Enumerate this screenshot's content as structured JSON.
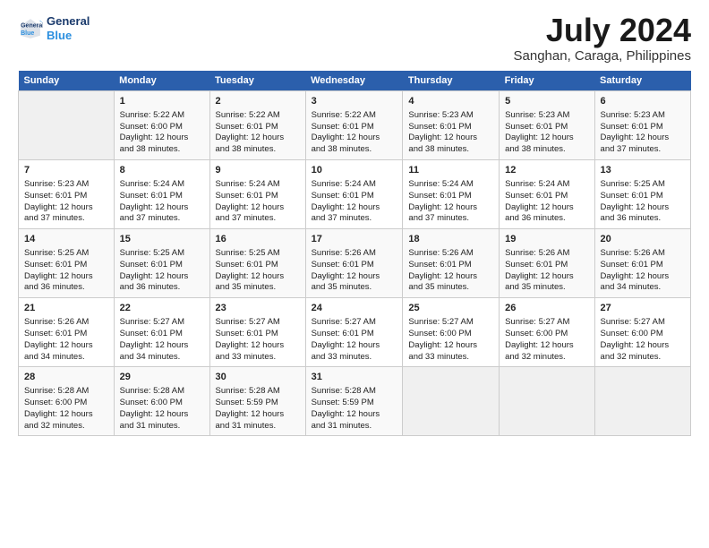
{
  "header": {
    "logo_line1": "General",
    "logo_line2": "Blue",
    "month": "July 2024",
    "location": "Sanghan, Caraga, Philippines"
  },
  "days_of_week": [
    "Sunday",
    "Monday",
    "Tuesday",
    "Wednesday",
    "Thursday",
    "Friday",
    "Saturday"
  ],
  "weeks": [
    [
      {
        "num": "",
        "detail": ""
      },
      {
        "num": "1",
        "detail": "Sunrise: 5:22 AM\nSunset: 6:00 PM\nDaylight: 12 hours\nand 38 minutes."
      },
      {
        "num": "2",
        "detail": "Sunrise: 5:22 AM\nSunset: 6:01 PM\nDaylight: 12 hours\nand 38 minutes."
      },
      {
        "num": "3",
        "detail": "Sunrise: 5:22 AM\nSunset: 6:01 PM\nDaylight: 12 hours\nand 38 minutes."
      },
      {
        "num": "4",
        "detail": "Sunrise: 5:23 AM\nSunset: 6:01 PM\nDaylight: 12 hours\nand 38 minutes."
      },
      {
        "num": "5",
        "detail": "Sunrise: 5:23 AM\nSunset: 6:01 PM\nDaylight: 12 hours\nand 38 minutes."
      },
      {
        "num": "6",
        "detail": "Sunrise: 5:23 AM\nSunset: 6:01 PM\nDaylight: 12 hours\nand 37 minutes."
      }
    ],
    [
      {
        "num": "7",
        "detail": "Sunrise: 5:23 AM\nSunset: 6:01 PM\nDaylight: 12 hours\nand 37 minutes."
      },
      {
        "num": "8",
        "detail": "Sunrise: 5:24 AM\nSunset: 6:01 PM\nDaylight: 12 hours\nand 37 minutes."
      },
      {
        "num": "9",
        "detail": "Sunrise: 5:24 AM\nSunset: 6:01 PM\nDaylight: 12 hours\nand 37 minutes."
      },
      {
        "num": "10",
        "detail": "Sunrise: 5:24 AM\nSunset: 6:01 PM\nDaylight: 12 hours\nand 37 minutes."
      },
      {
        "num": "11",
        "detail": "Sunrise: 5:24 AM\nSunset: 6:01 PM\nDaylight: 12 hours\nand 37 minutes."
      },
      {
        "num": "12",
        "detail": "Sunrise: 5:24 AM\nSunset: 6:01 PM\nDaylight: 12 hours\nand 36 minutes."
      },
      {
        "num": "13",
        "detail": "Sunrise: 5:25 AM\nSunset: 6:01 PM\nDaylight: 12 hours\nand 36 minutes."
      }
    ],
    [
      {
        "num": "14",
        "detail": "Sunrise: 5:25 AM\nSunset: 6:01 PM\nDaylight: 12 hours\nand 36 minutes."
      },
      {
        "num": "15",
        "detail": "Sunrise: 5:25 AM\nSunset: 6:01 PM\nDaylight: 12 hours\nand 36 minutes."
      },
      {
        "num": "16",
        "detail": "Sunrise: 5:25 AM\nSunset: 6:01 PM\nDaylight: 12 hours\nand 35 minutes."
      },
      {
        "num": "17",
        "detail": "Sunrise: 5:26 AM\nSunset: 6:01 PM\nDaylight: 12 hours\nand 35 minutes."
      },
      {
        "num": "18",
        "detail": "Sunrise: 5:26 AM\nSunset: 6:01 PM\nDaylight: 12 hours\nand 35 minutes."
      },
      {
        "num": "19",
        "detail": "Sunrise: 5:26 AM\nSunset: 6:01 PM\nDaylight: 12 hours\nand 35 minutes."
      },
      {
        "num": "20",
        "detail": "Sunrise: 5:26 AM\nSunset: 6:01 PM\nDaylight: 12 hours\nand 34 minutes."
      }
    ],
    [
      {
        "num": "21",
        "detail": "Sunrise: 5:26 AM\nSunset: 6:01 PM\nDaylight: 12 hours\nand 34 minutes."
      },
      {
        "num": "22",
        "detail": "Sunrise: 5:27 AM\nSunset: 6:01 PM\nDaylight: 12 hours\nand 34 minutes."
      },
      {
        "num": "23",
        "detail": "Sunrise: 5:27 AM\nSunset: 6:01 PM\nDaylight: 12 hours\nand 33 minutes."
      },
      {
        "num": "24",
        "detail": "Sunrise: 5:27 AM\nSunset: 6:01 PM\nDaylight: 12 hours\nand 33 minutes."
      },
      {
        "num": "25",
        "detail": "Sunrise: 5:27 AM\nSunset: 6:00 PM\nDaylight: 12 hours\nand 33 minutes."
      },
      {
        "num": "26",
        "detail": "Sunrise: 5:27 AM\nSunset: 6:00 PM\nDaylight: 12 hours\nand 32 minutes."
      },
      {
        "num": "27",
        "detail": "Sunrise: 5:27 AM\nSunset: 6:00 PM\nDaylight: 12 hours\nand 32 minutes."
      }
    ],
    [
      {
        "num": "28",
        "detail": "Sunrise: 5:28 AM\nSunset: 6:00 PM\nDaylight: 12 hours\nand 32 minutes."
      },
      {
        "num": "29",
        "detail": "Sunrise: 5:28 AM\nSunset: 6:00 PM\nDaylight: 12 hours\nand 31 minutes."
      },
      {
        "num": "30",
        "detail": "Sunrise: 5:28 AM\nSunset: 5:59 PM\nDaylight: 12 hours\nand 31 minutes."
      },
      {
        "num": "31",
        "detail": "Sunrise: 5:28 AM\nSunset: 5:59 PM\nDaylight: 12 hours\nand 31 minutes."
      },
      {
        "num": "",
        "detail": ""
      },
      {
        "num": "",
        "detail": ""
      },
      {
        "num": "",
        "detail": ""
      }
    ]
  ]
}
